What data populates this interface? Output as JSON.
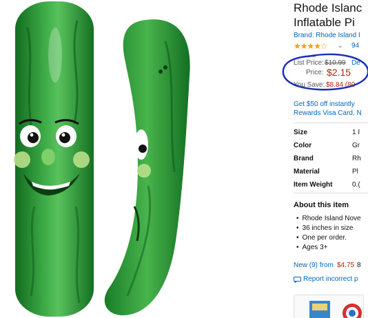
{
  "product": {
    "title_line1": "Rhode Islanc",
    "title_line2": "Inflatable Pi",
    "brand": "Brand: Rhode Island I",
    "stars": "★★★★☆",
    "review_count": "94",
    "list_price_label": "List Price:",
    "list_price_value": "$10.99",
    "deal_link": "De",
    "price_label": "Price:",
    "price_value": "$2.15",
    "save_label": "You Save:",
    "save_value": "$8.84 (80",
    "promo_line1": "Get $50 off instantly",
    "promo_line2": "Rewards Visa Card. N"
  },
  "specs": [
    {
      "key": "Size",
      "value": "1 I"
    },
    {
      "key": "Color",
      "value": "Gr"
    },
    {
      "key": "Brand",
      "value": "Rh"
    },
    {
      "key": "Material",
      "value": "Pl"
    },
    {
      "key": "Item Weight",
      "value": "0.("
    }
  ],
  "about": {
    "heading": "About this item",
    "bullets": [
      "Rhode Island Nove",
      "36 inches in size",
      "One per order.",
      "Ages 3+"
    ]
  },
  "offers": {
    "new_link": "New (9) from",
    "new_price": "$4.75",
    "new_extra": "8"
  },
  "report": {
    "label": "Report incorrect p"
  },
  "colors": {
    "pickle_dark": "#1c7a2a",
    "pickle_mid": "#2e9a3a",
    "pickle_light": "#5cc860",
    "link": "#0066c0",
    "price_red": "#b12704",
    "annotation_blue": "#1a2fb8",
    "star": "#f0a000"
  },
  "icons": {
    "report_icon": "speech-bubble-icon",
    "chevron": "chevron-down-icon"
  }
}
